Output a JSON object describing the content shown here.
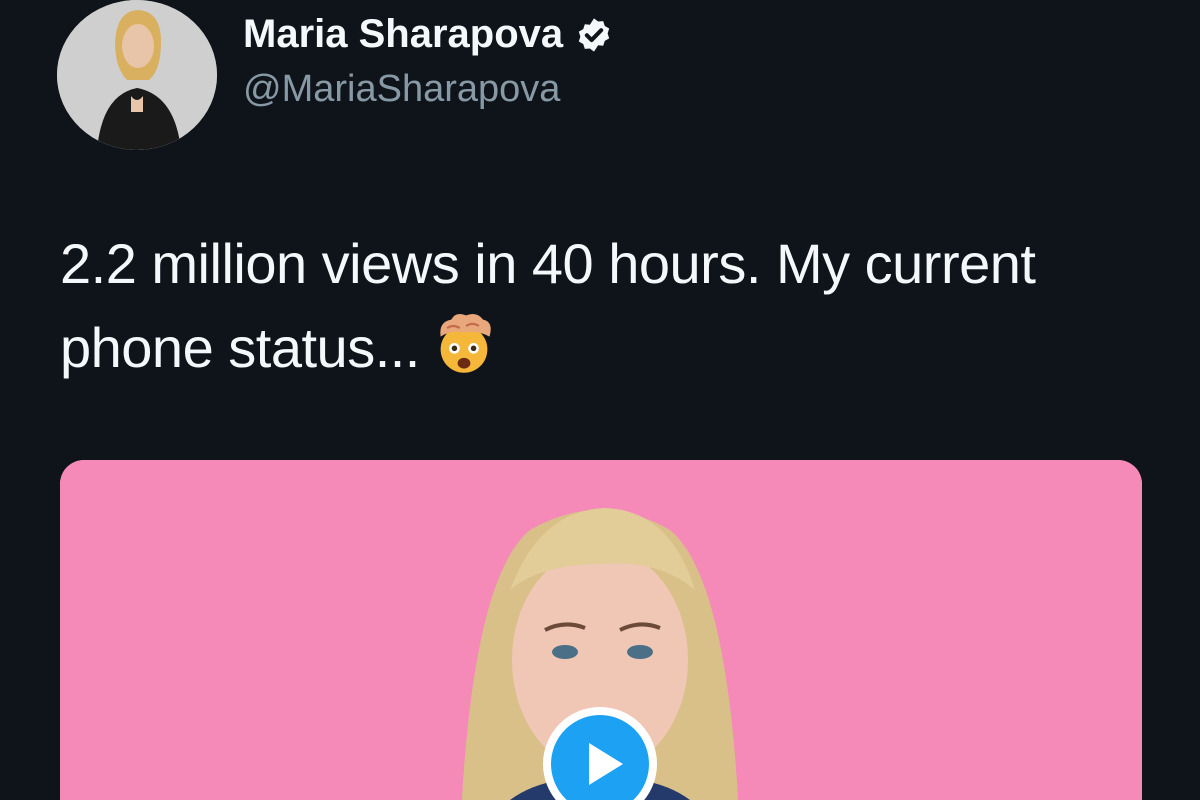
{
  "tweet": {
    "author": {
      "display_name": "Maria Sharapova",
      "handle": "@MariaSharapova",
      "verified": true,
      "avatar_icon": "profile-photo"
    },
    "text_line1": "2.2 million views in 40 hours. My current",
    "text_line2": "phone status...",
    "emoji": "exploding-head-emoji",
    "media": {
      "type": "video",
      "background_color": "#f58ab9",
      "play_icon": "play-icon"
    }
  },
  "colors": {
    "background": "#0f141b",
    "text_primary": "#f5f8fa",
    "text_secondary": "#8899a6",
    "accent": "#1da1f2"
  }
}
